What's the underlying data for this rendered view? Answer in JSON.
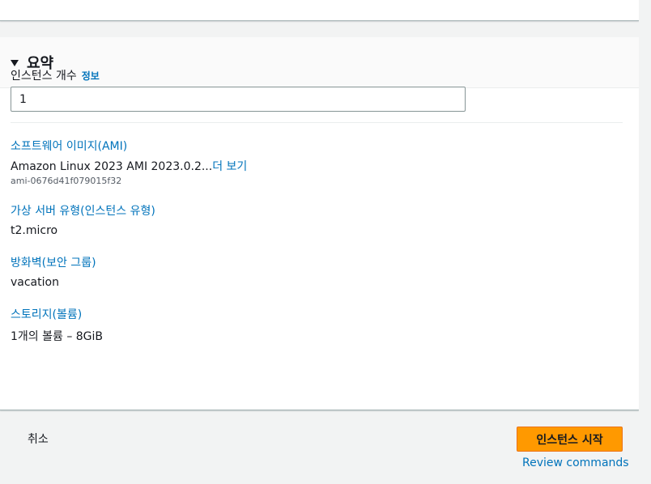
{
  "summary": {
    "title": "요약",
    "instance_count": {
      "label": "인스턴스 개수",
      "info_link": "정보",
      "value": "1"
    },
    "ami": {
      "title": "소프트웨어 이미지(AMI)",
      "value": "Amazon Linux 2023 AMI 2023.0.2...",
      "more_link": "더 보기",
      "id": "ami-0676d41f079015f32"
    },
    "instance_type": {
      "title": "가상 서버 유형(인스턴스 유형)",
      "value": "t2.micro"
    },
    "firewall": {
      "title": "방화벽(보안 그룹)",
      "value": "vacation"
    },
    "storage": {
      "title": "스토리지(볼륨)",
      "value": "1개의 볼륨 – 8GiB"
    }
  },
  "footer": {
    "cancel_label": "취소",
    "launch_label": "인스턴스 시작",
    "review_label": "Review commands"
  },
  "colors": {
    "link": "#0073bb",
    "primary_button": "#ff9900",
    "page_background": "#f2f3f3"
  }
}
